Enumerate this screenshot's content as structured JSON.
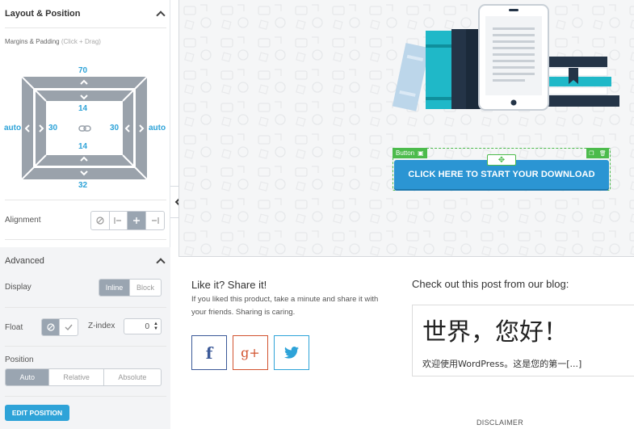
{
  "layout_section": {
    "title": "Layout & Position",
    "margins_label": "Margins & Padding",
    "margins_hint": "(Click + Drag)",
    "margin": {
      "top": "70",
      "bottom": "32",
      "left": "auto",
      "right": "auto"
    },
    "padding": {
      "top": "14",
      "bottom": "14",
      "left": "30",
      "right": "30"
    },
    "alignment_label": "Alignment"
  },
  "advanced_section": {
    "title": "Advanced",
    "display_label": "Display",
    "display_options": [
      "Inline",
      "Block"
    ],
    "display_selected": "Inline",
    "float_label": "Float",
    "zindex_label": "Z-index",
    "zindex_value": "0",
    "position_label": "Position",
    "position_options": [
      "Auto",
      "Relative",
      "Absolute"
    ],
    "position_selected": "Auto",
    "edit_position_label": "EDIT POSITION"
  },
  "canvas": {
    "element_badge": "Button",
    "download_button_label": "CLICK HERE TO START YOUR DOWNLOAD"
  },
  "share": {
    "title": "Like it? Share it!",
    "text": "If you liked this product, take a minute and share it with your friends. Sharing is caring.",
    "facebook_glyph": "f",
    "gplus_glyph": "g+"
  },
  "blog": {
    "title": "Check out this post from our blog:",
    "post_heading": "世界，您好！",
    "post_excerpt": "欢迎使用WordPress。这是您的第一[...]"
  },
  "footer": {
    "disclaimer": "DISCLAIMER"
  },
  "colors": {
    "accent": "#2ea3d8",
    "selection": "#4cbb4c",
    "button": "#2b95d3",
    "facebook": "#3b5998",
    "gplus": "#d2532f"
  }
}
